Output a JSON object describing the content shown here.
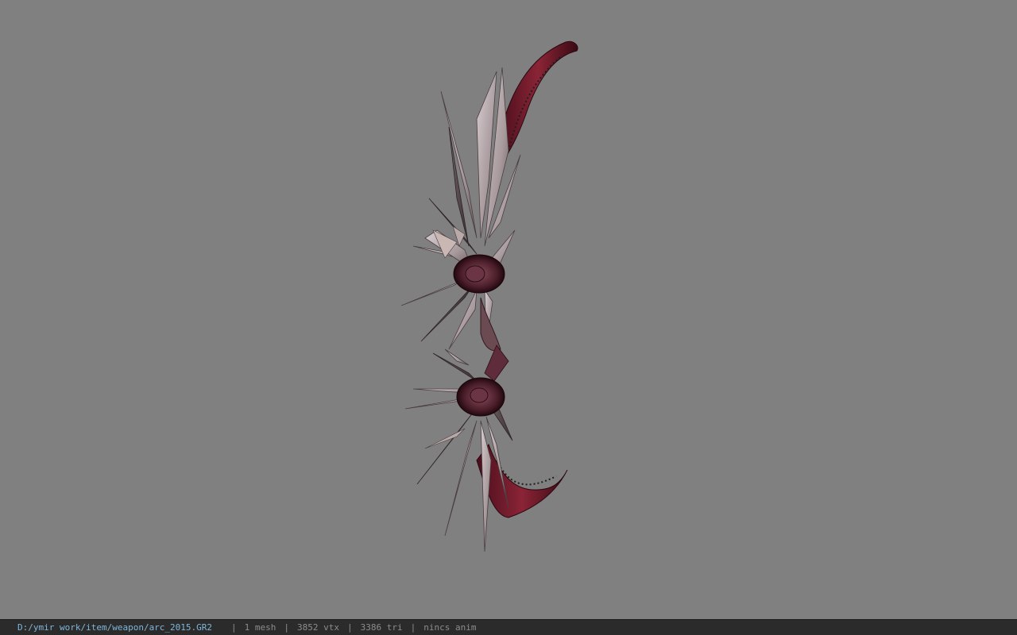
{
  "viewer": {
    "background_color": "#808080",
    "model_name": "arc_2015"
  },
  "status_bar": {
    "file_path": "D:/ymir work/item/weapon/arc_2015.GR2",
    "separator": "|",
    "mesh_count": "1 mesh",
    "vertex_count": "3852 vtx",
    "triangle_count": "3386 tri",
    "animation": "nincs anim",
    "colors": {
      "path": "#7fb6d9",
      "text": "#8c8c8c",
      "background": "#2b2b2b"
    }
  }
}
